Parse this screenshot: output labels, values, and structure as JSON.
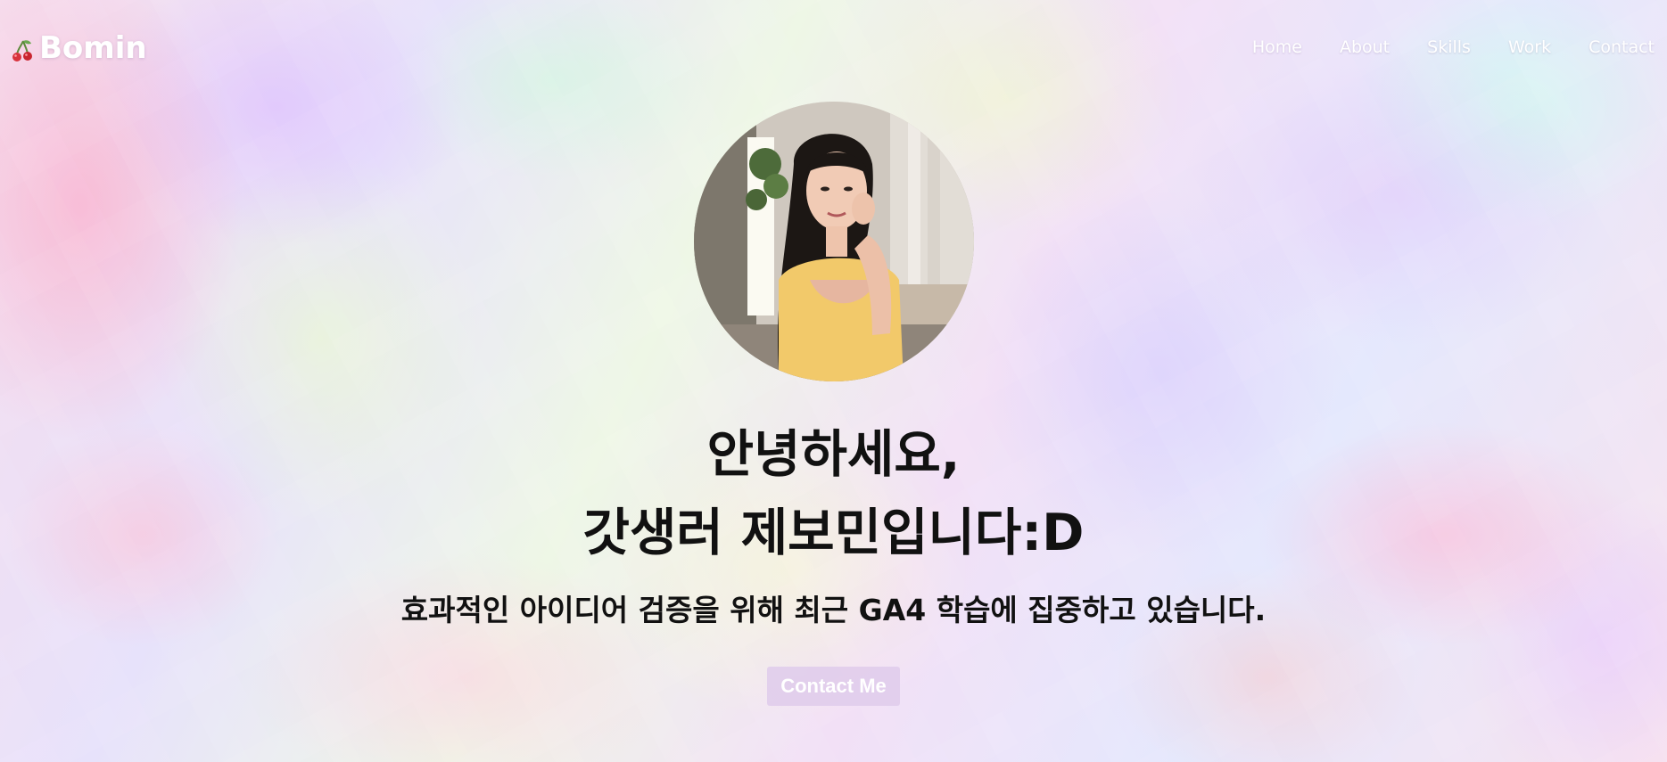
{
  "brand": {
    "icon": "cherry-icon",
    "name": "Bomin"
  },
  "nav": {
    "items": [
      "Home",
      "About",
      "Skills",
      "Work",
      "Contact"
    ]
  },
  "hero": {
    "avatar": "profile-photo",
    "title_line1": "안녕하세요,",
    "title_line2": "갓생러 제보민입니다:D",
    "subtitle": "효과적인 아이디어 검증을 위해 최근 GA4 학습에 집중하고 있습니다.",
    "cta_label": "Contact Me"
  },
  "colors": {
    "text": "#111111",
    "nav_text": "#ffffff",
    "cta_bg": "#e1cdeb",
    "cta_text": "#ffffff"
  }
}
